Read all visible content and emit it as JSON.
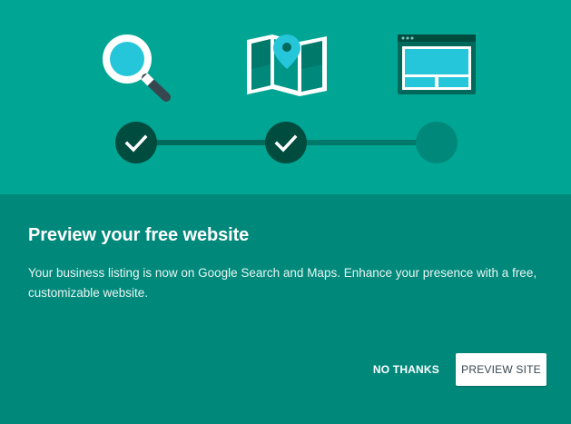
{
  "colors": {
    "hero_bg": "#00a594",
    "content_bg": "#00897b",
    "step_done": "#004d40",
    "step_todo": "#00897b",
    "accent_cyan": "#26c6da"
  },
  "illustrations": [
    {
      "icon": "magnifier-icon"
    },
    {
      "icon": "map-pin-icon"
    },
    {
      "icon": "website-icon"
    }
  ],
  "stepper": {
    "total_steps": 3,
    "completed_steps": 2
  },
  "dialog": {
    "title": "Preview your free website",
    "body": "Your business listing is now on Google Search and Maps. Enhance your presence with a free, customizable website."
  },
  "actions": {
    "dismiss_label": "NO THANKS",
    "confirm_label": "PREVIEW SITE"
  }
}
